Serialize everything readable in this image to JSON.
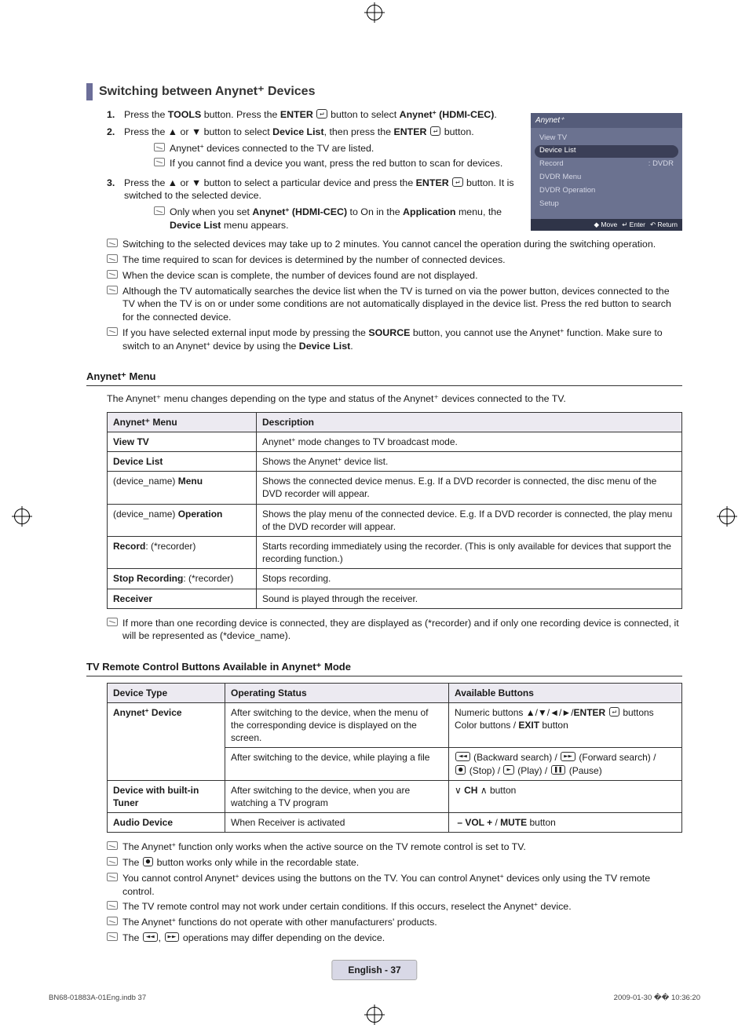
{
  "section_title": "Switching between Anynet⁺ Devices",
  "steps": [
    {
      "n": "1.",
      "html": "Press the <b>TOOLS</b> button. Press the <b>ENTER</b> <span class='enter-icon'>↵</span> button to select <b>Anynet<sup>+</sup> (HDMI-CEC)</b>."
    },
    {
      "n": "2.",
      "html": "Press the ▲ or ▼ button to select <b>Device List</b>, then press the <b>ENTER</b> <span class='enter-icon'>↵</span> button.",
      "sub": [
        "Anynet<sup>+</sup> devices connected to the TV are listed.",
        "If you cannot find a device you want, press the red button to scan for devices."
      ]
    },
    {
      "n": "3.",
      "html": "Press the ▲ or ▼ button to select a particular device and press the <b>ENTER</b> <span class='enter-icon'>↵</span> button. It is switched to the selected device.",
      "sub": [
        "Only when you set <b>Anynet<sup>+</sup> (HDMI-CEC)</b> to On in the <b>Application</b> menu, the <b>Device List</b> menu appears."
      ]
    }
  ],
  "top_notes": [
    "Switching to the selected devices may take up to 2 minutes. You cannot cancel the operation during the switching operation.",
    "The time required to scan for devices is determined by the number of connected devices.",
    "When the device scan is complete, the number of devices found are not displayed.",
    "Although the TV automatically searches the device list when the TV is turned on via the power button, devices connected to the TV when the TV is on or under some conditions are not automatically displayed in the device list. Press the red button to search for the connected device.",
    "If you have selected external input mode by pressing the <b>SOURCE</b> button, you cannot use the Anynet<sup>+</sup> function. Make sure to switch to an Anynet<sup>+</sup> device by using the <b>Device List</b>."
  ],
  "screenshot": {
    "title": "Anynet⁺",
    "rows": [
      {
        "l": "View TV",
        "r": ""
      },
      {
        "l": "Device List",
        "r": "",
        "sel": true
      },
      {
        "l": "Record",
        "r": ": DVDR"
      },
      {
        "l": "DVDR Menu",
        "r": ""
      },
      {
        "l": "DVDR Operation",
        "r": ""
      },
      {
        "l": "Setup",
        "r": ""
      }
    ],
    "foot": [
      "◆ Move",
      "↵ Enter",
      "↶ Return"
    ]
  },
  "menu_sec_title": "Anynet⁺ Menu",
  "menu_intro": "The Anynet⁺ menu changes depending on the type and status of the Anynet⁺ devices connected to the TV.",
  "menu_table_head": [
    "Anynet⁺ Menu",
    "Description"
  ],
  "menu_table": [
    [
      "<b>View TV</b>",
      "Anynet<sup>+</sup> mode changes to TV broadcast mode."
    ],
    [
      "<b>Device List</b>",
      "Shows the Anynet<sup>+</sup> device list."
    ],
    [
      "(device_name) <b>Menu</b>",
      "Shows the connected device menus. E.g. If a DVD recorder is connected, the disc menu of the DVD recorder will appear."
    ],
    [
      "(device_name) <b>Operation</b>",
      "Shows the play menu of the connected device. E.g. If a DVD recorder is connected, the play menu of the DVD recorder will appear."
    ],
    [
      "<b>Record</b>: (*recorder)",
      "Starts recording immediately using the recorder. (This is only available for devices that support the recording function.)"
    ],
    [
      "<b>Stop Recording</b>: (*recorder)",
      "Stops recording."
    ],
    [
      "<b>Receiver</b>",
      "Sound is played through the receiver."
    ]
  ],
  "menu_note": "If more than one recording device is connected, they are displayed as (*recorder) and if only one recording device is connected, it will be represented as (*device_name).",
  "remote_sec_title": "TV Remote Control Buttons Available in Anynet⁺ Mode",
  "remote_table_head": [
    "Device Type",
    "Operating Status",
    "Available Buttons"
  ],
  "remote_table": [
    {
      "dt": "Anynet<sup>+</sup> Device",
      "rows": [
        [
          "After switching to the device, when the menu of the corresponding device is displayed on the screen.",
          "Numeric buttons ▲/▼/◄/►/<b>ENTER</b> <span class='enter-icon'>↵</span> buttons<br>Color buttons / <b>EXIT</b> button"
        ],
        [
          "After switching to the device, while playing a file",
          "<span class='btn-icon'>◄◄</span> (Backward search) / <span class='btn-icon'>►►</span> (Forward search) /<br><span class='btn-icon'>●</span> (Stop) / <span class='btn-icon'>►</span> (Play) / <span class='btn-icon'>❚❚</span> (Pause)"
        ]
      ]
    },
    {
      "dt": "Device with built-in Tuner",
      "rows": [
        [
          "After switching to the device, when you are watching a TV program",
          "<span class='sym'>∨</span> <b>CH</b> <span class='sym'>∧</span> button"
        ]
      ]
    },
    {
      "dt": "Audio Device",
      "rows": [
        [
          "When Receiver is activated",
          "<b>&nbsp;– VOL +</b> / <b>MUTE</b> button"
        ]
      ]
    }
  ],
  "bottom_notes": [
    "The Anynet<sup>+</sup> function only works when the active source on the TV remote control is set to TV.",
    "The <span class='btn-icon'>●</span> button works only while in the recordable state.",
    "You cannot control Anynet<sup>+</sup> devices using the buttons on the TV. You can control Anynet<sup>+</sup> devices only using the TV remote control.",
    "The TV remote control may not work under certain conditions. If this occurs, reselect the Anynet<sup>+</sup> device.",
    "The Anynet<sup>+</sup> functions do not operate with other manufacturers' products.",
    "The <span class='btn-icon'>◄◄</span>, <span class='btn-icon'>►►</span> operations may differ depending on the device."
  ],
  "page_lang": "English - 37",
  "footer_l": "BN68-01883A-01Eng.indb   37",
  "footer_r": "2009-01-30   �� 10:36:20"
}
